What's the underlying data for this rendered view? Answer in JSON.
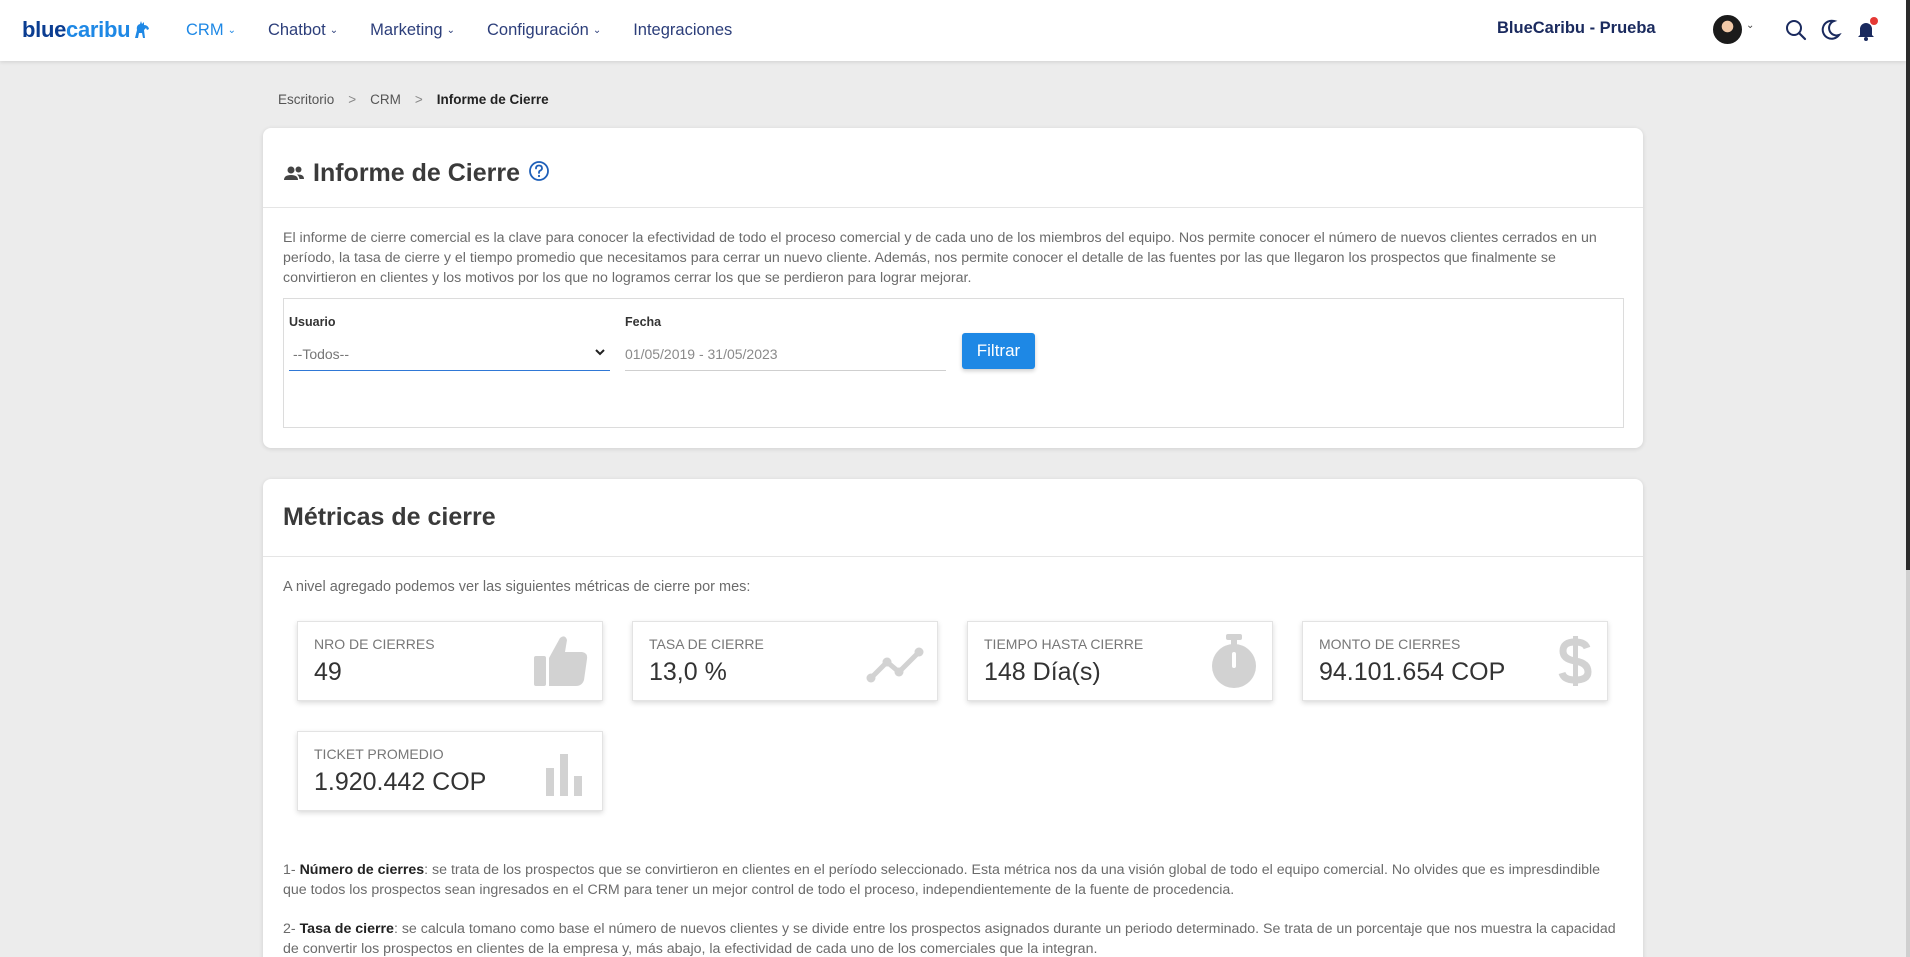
{
  "brand": {
    "part1": "blue",
    "part2": "caribu"
  },
  "nav": {
    "items": [
      {
        "label": "CRM",
        "caret": "⌄"
      },
      {
        "label": "Chatbot",
        "caret": "⌄"
      },
      {
        "label": "Marketing",
        "caret": "⌄"
      },
      {
        "label": "Configuración",
        "caret": "⌄"
      },
      {
        "label": "Integraciones"
      }
    ],
    "company": "BlueCaribu - Prueba"
  },
  "breadcrumb": [
    "Escritorio",
    "CRM",
    "Informe de Cierre"
  ],
  "breadcrumb_sep": ">",
  "report": {
    "title": "Informe de Cierre",
    "description": "El informe de cierre comercial es la clave para conocer la efectividad de todo el proceso comercial y de cada uno de los miembros del equipo. Nos permite conocer el número de nuevos clientes cerrados en un período, la tasa de cierre y el tiempo promedio que necesitamos para cerrar un nuevo cliente. Además, nos permite conocer el detalle de las fuentes por las que llegaron los prospectos que finalmente se convirtieron en clientes y los motivos por los que no logramos cerrar los que se perdieron para lograr mejorar.",
    "filters": {
      "user_label": "Usuario",
      "user_value": "--Todos--",
      "date_label": "Fecha",
      "date_value": "01/05/2019 - 31/05/2023",
      "button": "Filtrar"
    }
  },
  "metrics": {
    "title": "Métricas de cierre",
    "subtitle": "A nivel agregado podemos ver las siguientes métricas de cierre por mes:",
    "cards": [
      {
        "label": "NRO DE CIERRES",
        "value": "49",
        "icon": "thumbs-up-icon"
      },
      {
        "label": "TASA DE CIERRE",
        "value": "13,0 %",
        "icon": "trend-line-icon"
      },
      {
        "label": "TIEMPO HASTA CIERRE",
        "value": "148 Día(s)",
        "icon": "stopwatch-icon"
      },
      {
        "label": "MONTO DE CIERRES",
        "value": "94.101.654 COP",
        "icon": "dollar-icon"
      },
      {
        "label": "TICKET PROMEDIO",
        "value": "1.920.442 COP",
        "icon": "bar-chart-icon"
      }
    ],
    "notes": [
      {
        "prefix": "1- ",
        "term": "Número de cierres",
        "text": ": se trata de los prospectos que se convirtieron en clientes en el período seleccionado. Esta métrica nos da una visión global de todo el equipo comercial. No olvides que es impresdindible que todos los prospectos sean ingresados en el CRM para tener un mejor control de todo el proceso, independientemente de la fuente de procedencia."
      },
      {
        "prefix": "2- ",
        "term": "Tasa de cierre",
        "text": ": se calcula tomano como base el número de nuevos clientes y se divide entre los prospectos asignados durante un periodo determinado. Se trata de un porcentaje que nos muestra la capacidad de convertir los prospectos en clientes de la empresa y, más abajo, la efectividad de cada uno de los comerciales que la integran."
      }
    ]
  },
  "colors": {
    "primary": "#1e88e5",
    "nav_text": "#2c3e7a",
    "brand_dark": "#0b3d91",
    "notification": "#e53935"
  }
}
